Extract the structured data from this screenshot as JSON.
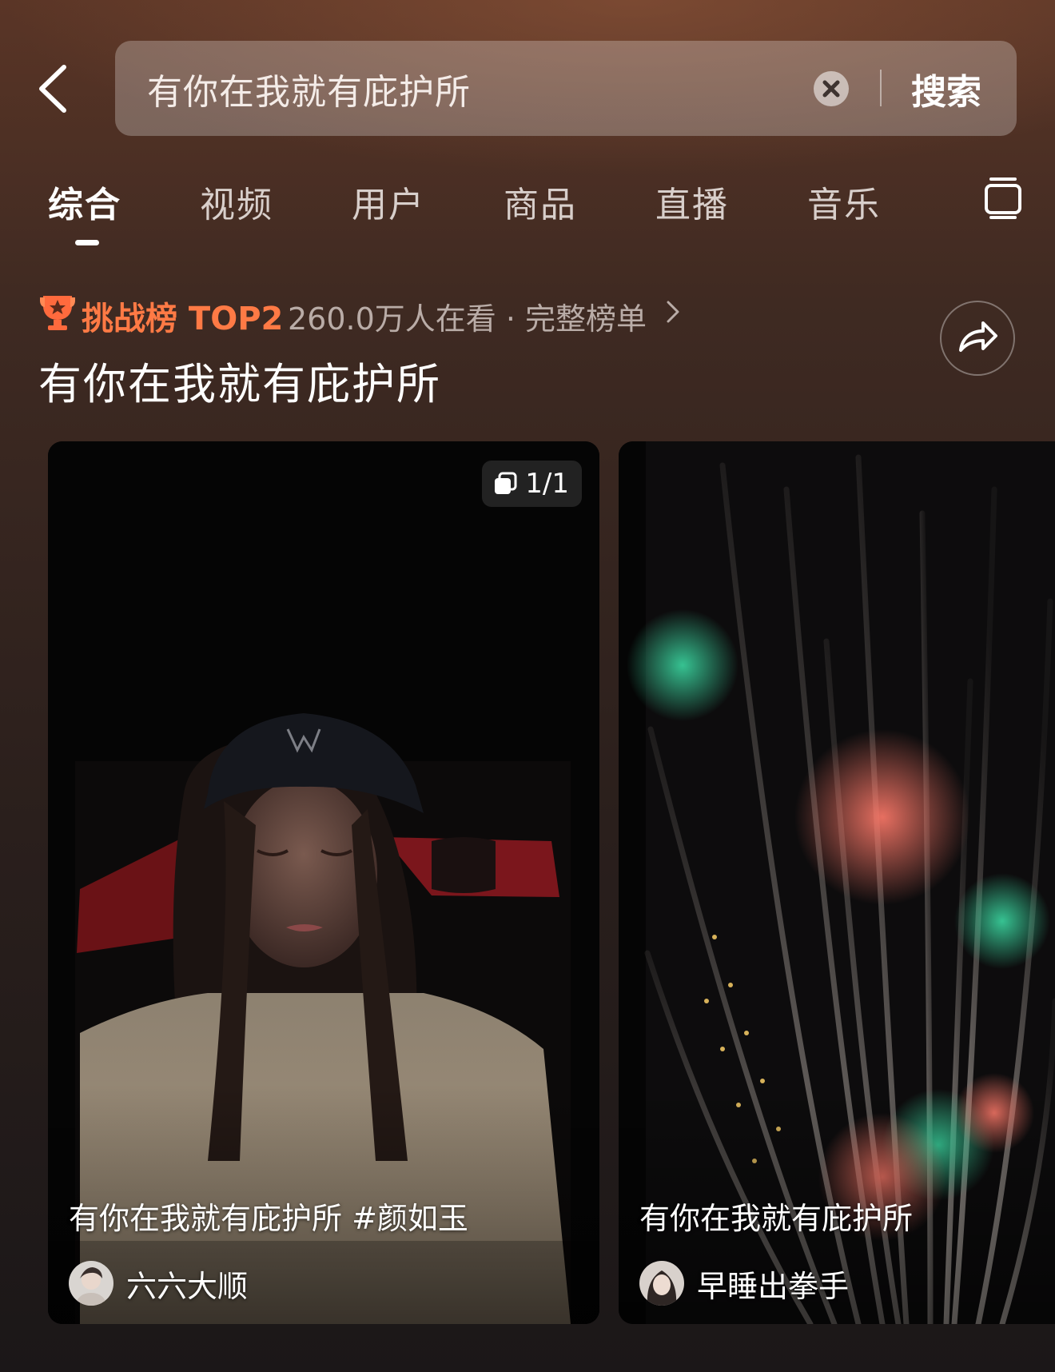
{
  "header": {
    "back_icon": "chevron-left-icon",
    "search": {
      "query": "有你在我就有庇护所",
      "clear_icon": "close-circle-icon",
      "submit_label": "搜索"
    }
  },
  "tabs": [
    {
      "label": "综合",
      "active": true
    },
    {
      "label": "视频",
      "active": false
    },
    {
      "label": "用户",
      "active": false
    },
    {
      "label": "商品",
      "active": false
    },
    {
      "label": "直播",
      "active": false
    },
    {
      "label": "音乐",
      "active": false
    }
  ],
  "tabs_more_icon": "layout-toggle-icon",
  "challenge": {
    "trophy_icon": "trophy-icon",
    "label": "挑战榜 TOP2",
    "viewers": "260.0万人在看 · 完整榜单",
    "topic_title": "有你在我就有庇护所",
    "share_icon": "share-arrow-icon"
  },
  "cards": [
    {
      "caption": "有你在我就有庇护所 #颜如玉",
      "author": "六六大顺",
      "counter": "1/1",
      "counter_icon": "gallery-icon"
    },
    {
      "caption": "有你在我就有庇护所",
      "author": "早睡出拳手"
    }
  ],
  "colors": {
    "accent": "#ff7a45",
    "background": "#2a1f1c"
  }
}
